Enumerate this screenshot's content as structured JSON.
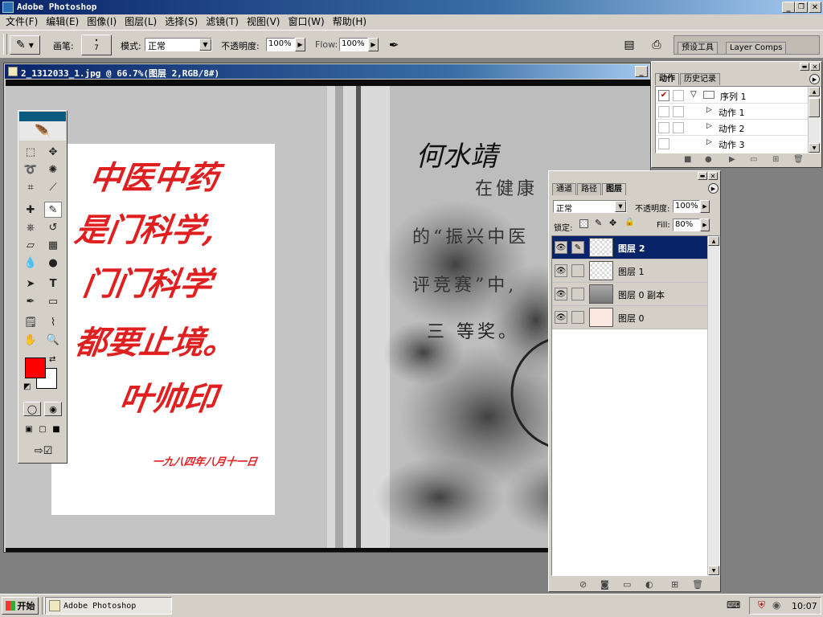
{
  "app": {
    "title": "Adobe Photoshop",
    "window_controls": {
      "min": "_",
      "max": "❐",
      "close": "✕"
    }
  },
  "menu": [
    "文件(F)",
    "编辑(E)",
    "图像(I)",
    "图层(L)",
    "选择(S)",
    "滤镜(T)",
    "视图(V)",
    "窗口(W)",
    "帮助(H)"
  ],
  "options_bar": {
    "brush_label": "画笔:",
    "brush_size": "7",
    "mode_label": "模式:",
    "mode_value": "正常",
    "opacity_label": "不透明度:",
    "opacity_value": "100%",
    "flow_label": "Flow:",
    "flow_value": "100%",
    "well_tabs": [
      "预设工具",
      "Layer Comps"
    ]
  },
  "document": {
    "title": "2_1312033_1.jpg @ 66.7%(图层 2,RGB/8#)",
    "zoom_percent": 66.7,
    "page_text": {
      "signature": "何水靖",
      "line1": "在健康",
      "line2": "的“振兴中医",
      "line3": "评竞赛”中,",
      "line4": "三  等奖。"
    },
    "calligraphy_lines": [
      "中医中药",
      "是门科学,",
      "门门科学",
      "都要止境。",
      "叶帅印",
      "一九八四年八月十一日"
    ],
    "calligraphy_color": "#e02020"
  },
  "toolbox": {
    "foreground_color": "#ff0000",
    "background_color": "#ffffff"
  },
  "actions_panel": {
    "tabs": [
      "动作",
      "历史记录"
    ],
    "active_tab": "动作",
    "items": [
      {
        "label": "序列 1",
        "type": "set"
      },
      {
        "label": "动作 1",
        "type": "action"
      },
      {
        "label": "动作 2",
        "type": "action"
      },
      {
        "label": "动作 3",
        "type": "action"
      }
    ]
  },
  "layers_panel": {
    "tabs": [
      "通道",
      "路径",
      "图层"
    ],
    "active_tab": "图层",
    "blend_mode": "正常",
    "opacity_label": "不透明度:",
    "opacity_value": "100%",
    "lock_label": "锁定:",
    "fill_label": "Fill:",
    "fill_value": "80%",
    "layers": [
      {
        "name": "图层 2",
        "selected": true
      },
      {
        "name": "图层 1",
        "selected": false
      },
      {
        "name": "图层 0 副本",
        "selected": false
      },
      {
        "name": "图层 0",
        "selected": false
      }
    ]
  },
  "taskbar": {
    "start_label": "开始",
    "task_label": "Adobe Photoshop",
    "clock": "10:07"
  },
  "colors": {
    "chrome": "#d4d0c8",
    "title_blue": "#0a246a",
    "selection_blue": "#0a246a"
  }
}
